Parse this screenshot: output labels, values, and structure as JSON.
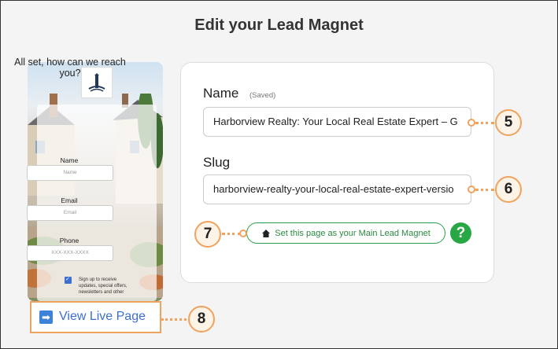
{
  "page": {
    "title": "Edit your Lead Magnet"
  },
  "preview": {
    "headline": "All set, how can we reach you?",
    "fields": [
      {
        "label": "Name",
        "placeholder": "Name"
      },
      {
        "label": "Email",
        "placeholder": "Email"
      },
      {
        "label": "Phone",
        "placeholder": "XXX-XXX-XXXX"
      }
    ],
    "consent_text": "Sign up to receive updates, special offers, newsletters and other"
  },
  "form": {
    "name_label": "Name",
    "saved_label": "(Saved)",
    "name_value": "Harborview Realty: Your Local Real Estate Expert – G",
    "slug_label": "Slug",
    "slug_value": "harborview-realty-your-local-real-estate-expert-versio",
    "main_button_label": "Set this page as your Main Lead Magnet",
    "help_label": "?"
  },
  "view_live": {
    "label": "View Live Page"
  },
  "callouts": {
    "c5": "5",
    "c6": "6",
    "c7": "7",
    "c8": "8"
  },
  "colors": {
    "accent_orange": "#f0a35e",
    "green": "#28a745",
    "link_blue": "#3b6fd4"
  }
}
